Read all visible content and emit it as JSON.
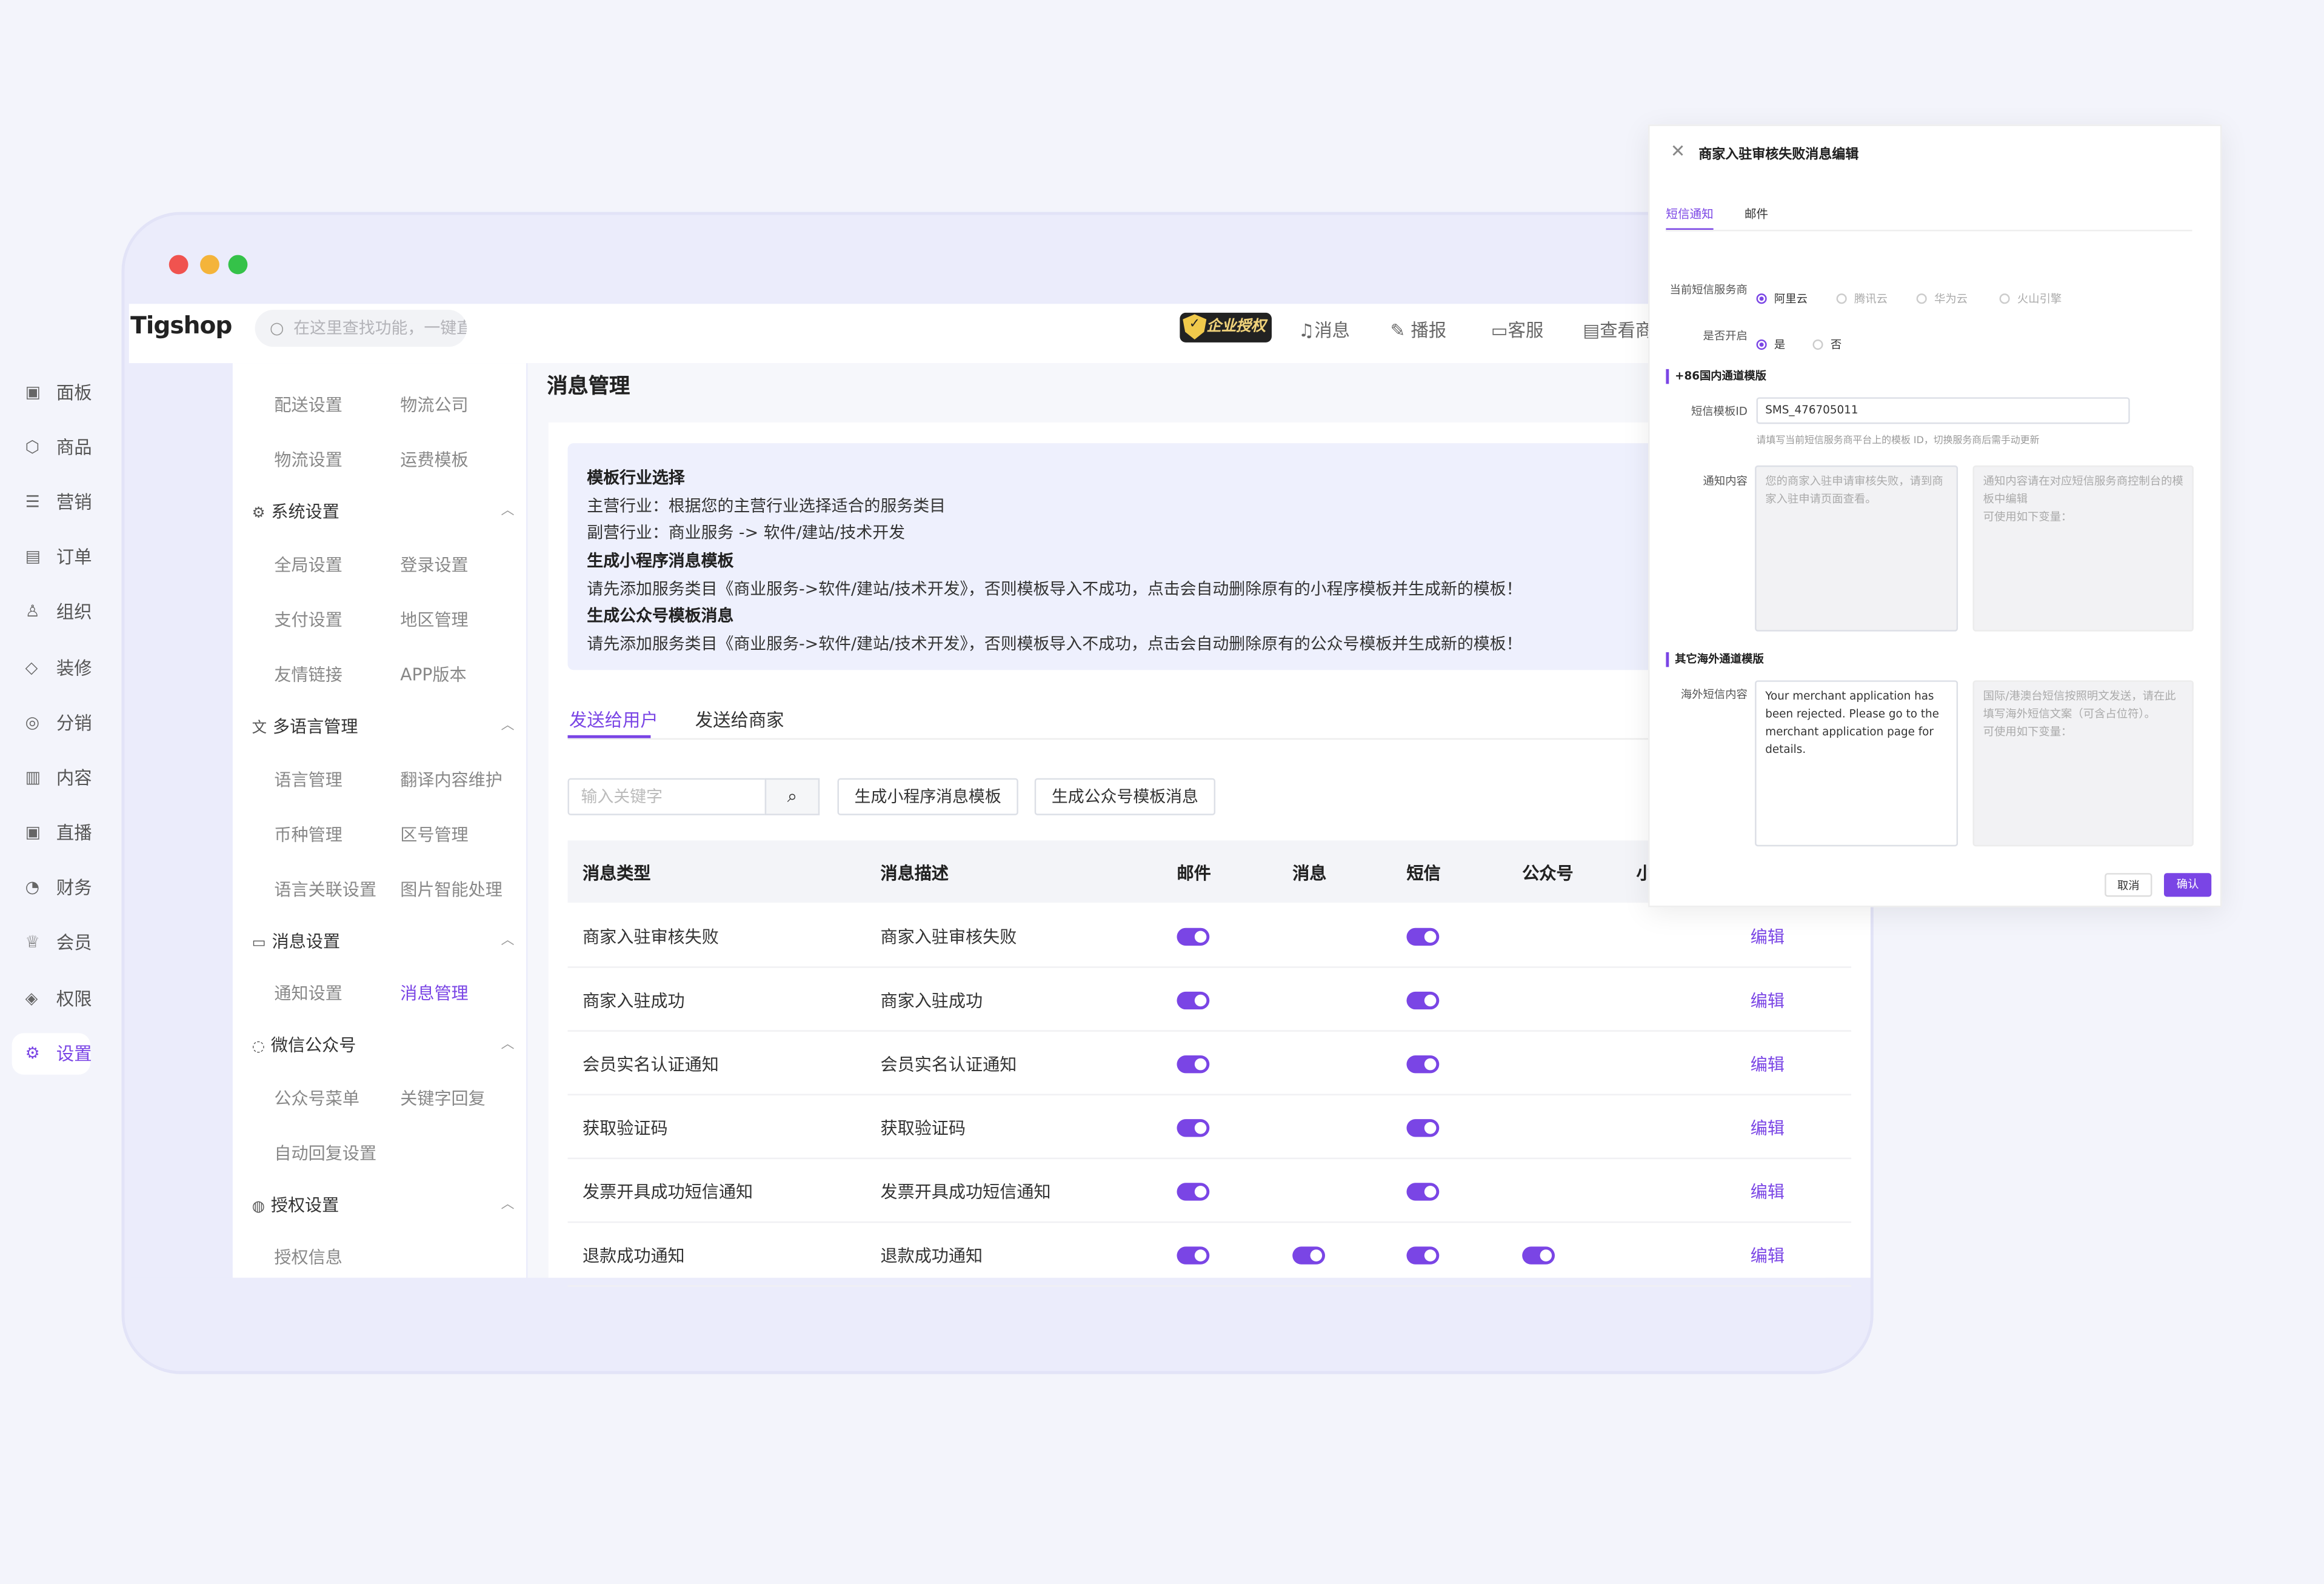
{
  "app": {
    "logo": "Tigshop"
  },
  "search": {
    "placeholder": "在这里查找功能，一键直达"
  },
  "header": {
    "badge": "企业授权",
    "items": [
      {
        "icon": "bell-icon",
        "label": "消息"
      },
      {
        "icon": "broadcast-icon",
        "label": "播报"
      },
      {
        "icon": "chat-icon",
        "label": "客服"
      },
      {
        "icon": "store-icon",
        "label": "查看商"
      }
    ]
  },
  "nav": [
    {
      "icon": "dashboard-icon",
      "label": "面板"
    },
    {
      "icon": "box-icon",
      "label": "商品"
    },
    {
      "icon": "marketing-icon",
      "label": "营销"
    },
    {
      "icon": "order-icon",
      "label": "订单"
    },
    {
      "icon": "user-icon",
      "label": "组织"
    },
    {
      "icon": "brush-icon",
      "label": "装修"
    },
    {
      "icon": "share-icon",
      "label": "分销"
    },
    {
      "icon": "content-icon",
      "label": "内容"
    },
    {
      "icon": "live-icon",
      "label": "直播"
    },
    {
      "icon": "finance-icon",
      "label": "财务"
    },
    {
      "icon": "member-icon",
      "label": "会员"
    },
    {
      "icon": "shield-icon",
      "label": "权限"
    },
    {
      "icon": "settings-icon",
      "label": "设置"
    }
  ],
  "submenu": {
    "top_links": [
      "配送设置",
      "物流公司",
      "物流设置",
      "运费模板"
    ],
    "groups": [
      {
        "title": "系统设置",
        "links": [
          "全局设置",
          "登录设置",
          "支付设置",
          "地区管理",
          "友情链接",
          "APP版本"
        ]
      },
      {
        "title": "多语言管理",
        "links": [
          "语言管理",
          "翻译内容维护",
          "币种管理",
          "区号管理",
          "语言关联设置",
          "图片智能处理"
        ]
      },
      {
        "title": "消息设置",
        "links": [
          "通知设置",
          "消息管理"
        ]
      },
      {
        "title": "微信公众号",
        "links": [
          "公众号菜单",
          "关键字回复",
          "自动回复设置"
        ]
      },
      {
        "title": "授权设置",
        "links": [
          "授权信息"
        ]
      }
    ]
  },
  "page": {
    "title": "消息管理"
  },
  "info": {
    "lines": [
      "模板行业选择",
      "主营行业：根据您的主营行业选择适合的服务类目",
      "副营行业：商业服务 -> 软件/建站/技术开发",
      "生成小程序消息模板",
      "请先添加服务类目《商业服务->软件/建站/技术开发》，否则模板导入不成功，点击会自动删除原有的小程序模板并生成新的模板！",
      "生成公众号模板消息",
      "请先添加服务类目《商业服务->软件/建站/技术开发》，否则模板导入不成功，点击会自动删除原有的公众号模板并生成新的模板！"
    ]
  },
  "tabs": [
    "发送给用户",
    "发送给商家"
  ],
  "toolbar": {
    "keyword_placeholder": "输入关键字",
    "btn_mini": "生成小程序消息模板",
    "btn_mp": "生成公众号模板消息"
  },
  "table": {
    "headers": [
      "消息类型",
      "消息描述",
      "邮件",
      "消息",
      "短信",
      "公众号",
      "小"
    ],
    "edit_label": "编辑",
    "rows": [
      {
        "type": "商家入驻审核失败",
        "desc": "商家入驻审核失败",
        "email": true,
        "msg": false,
        "sms": true,
        "mp": false
      },
      {
        "type": "商家入驻成功",
        "desc": "商家入驻成功",
        "email": true,
        "msg": false,
        "sms": true,
        "mp": false
      },
      {
        "type": "会员实名认证通知",
        "desc": "会员实名认证通知",
        "email": true,
        "msg": false,
        "sms": true,
        "mp": false
      },
      {
        "type": "获取验证码",
        "desc": "获取验证码",
        "email": true,
        "msg": false,
        "sms": true,
        "mp": false
      },
      {
        "type": "发票开具成功短信通知",
        "desc": "发票开具成功短信通知",
        "email": true,
        "msg": false,
        "sms": true,
        "mp": false
      },
      {
        "type": "退款成功通知",
        "desc": "退款成功通知",
        "email": true,
        "msg": true,
        "sms": true,
        "mp": true
      }
    ]
  },
  "modal": {
    "title": "商家入驻审核失败消息编辑",
    "tabs": [
      "短信通知",
      "邮件"
    ],
    "provider_label": "当前短信服务商",
    "providers": [
      "阿里云",
      "腾讯云",
      "华为云",
      "火山引擎"
    ],
    "enabled_label": "是否开启",
    "enabled_options": [
      "是",
      "否"
    ],
    "domestic_section": "+86国内通道模版",
    "template_id_label": "短信模板ID",
    "template_id_value": "SMS_476705011",
    "template_id_hint": "请填写当前短信服务商平台上的模板 ID，切换服务商后需手动更新",
    "content_label": "通知内容",
    "content_value": "您的商家入驻申请审核失败，请到商家入驻申请页面查看。",
    "content_help": "通知内容请在对应短信服务商控制台的模板中编辑\n可使用如下变量：",
    "overseas_section": "其它海外通道模版",
    "overseas_label": "海外短信内容",
    "overseas_value": "Your merchant application has been rejected. Please go to the merchant application page for details.",
    "overseas_help": "国际/港澳台短信按照明文发送，请在此填写海外短信文案（可含占位符）。\n可使用如下变量：",
    "cancel": "取消",
    "confirm": "确认"
  },
  "colors": {
    "accent": "#7a45e5",
    "page_bg": "#f3f4fb",
    "frame_bg": "#ebecfb"
  }
}
